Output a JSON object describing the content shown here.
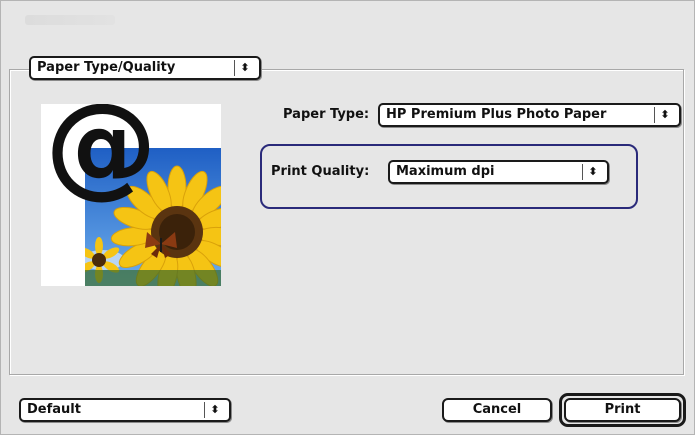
{
  "panel": {
    "selected": "Paper Type/Quality"
  },
  "paper_type": {
    "label": "Paper Type:",
    "selected": "HP Premium Plus Photo Paper"
  },
  "print_quality": {
    "label": "Print Quality:",
    "selected": "Maximum dpi"
  },
  "preview": {
    "symbol": "@"
  },
  "presets": {
    "selected": "Default"
  },
  "buttons": {
    "cancel": "Cancel",
    "print": "Print"
  },
  "icons": {
    "popup_arrows": "updown-arrows-icon"
  },
  "colors": {
    "dialog_bg": "#e6e6e6",
    "highlight_border": "#2a2a7a",
    "sky": "#2f79d6",
    "petals": "#f5c414"
  }
}
